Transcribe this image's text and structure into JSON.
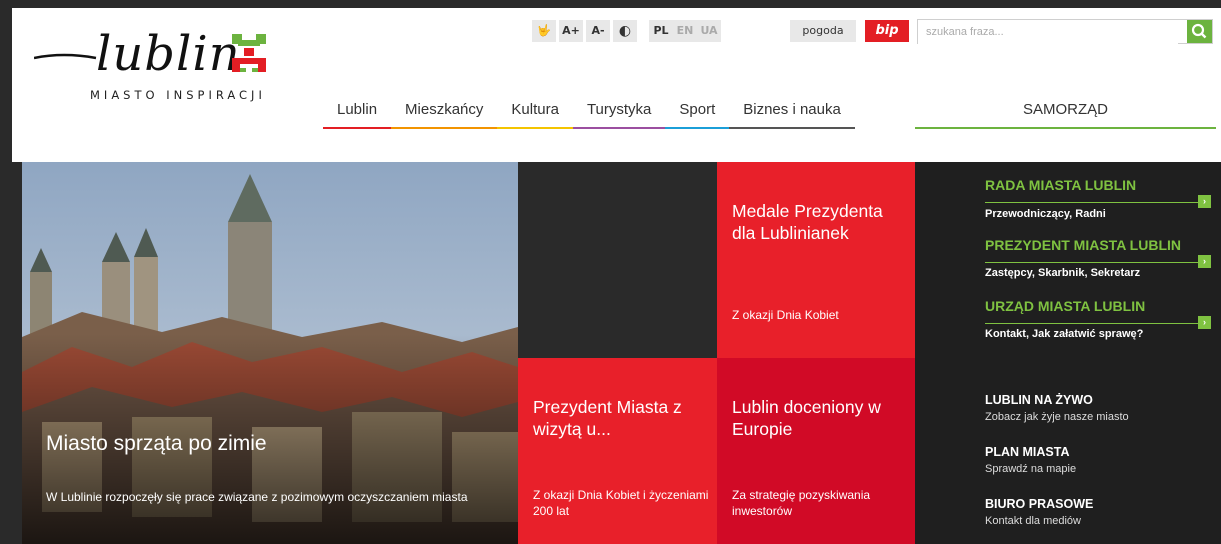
{
  "header": {
    "logo_word": "lublin",
    "logo_subtitle": "MIASTO INSPIRACJI",
    "tools": {
      "sign": "🤟",
      "font_up": "A+",
      "font_down": "A-",
      "contrast": "◐"
    },
    "languages": [
      {
        "code": "PL",
        "active": true
      },
      {
        "code": "EN",
        "active": false
      },
      {
        "code": "UA",
        "active": false
      }
    ],
    "weather_label": "pogoda",
    "bip_label": "bip",
    "search": {
      "placeholder": "szukana fraza..."
    },
    "nav": [
      {
        "label": "Lublin",
        "color": "#e31e24"
      },
      {
        "label": "Mieszkańcy",
        "color": "#f29400"
      },
      {
        "label": "Kultura",
        "color": "#f4c400"
      },
      {
        "label": "Turystyka",
        "color": "#9b4fa0"
      },
      {
        "label": "Sport",
        "color": "#1b9fd8"
      },
      {
        "label": "Biznes i nauka",
        "color": "#555555"
      }
    ],
    "samorzad_label": "SAMORZĄD"
  },
  "hero": {
    "title": "Miasto sprząta po zimie",
    "description": "W Lublinie rozpoczęły się prace związane z pozimowym oczyszczaniem miasta"
  },
  "tiles": [
    {
      "title": "Medale Prezydenta dla Lublinianek",
      "subtitle": "Z okazji Dnia Kobiet"
    },
    {
      "title": "Prezydent Miasta z wizytą u...",
      "subtitle": "Z okazji Dnia Kobiet i życzeniami 200 lat"
    },
    {
      "title": "Lublin doceniony w Europie",
      "subtitle": "Za strategię pozyskiwania inwestorów"
    }
  ],
  "sidebar": {
    "sections": [
      {
        "heading": "RADA MIASTA LUBLIN",
        "sub": "Przewodniczący, Radni"
      },
      {
        "heading": "PREZYDENT MIASTA LUBLIN",
        "sub": "Zastępcy, Skarbnik, Sekretarz"
      },
      {
        "heading": "URZĄD MIASTA LUBLIN",
        "sub": "Kontakt, Jak załatwić sprawę?"
      }
    ],
    "arrow": "›",
    "links": [
      {
        "heading": "LUBLIN NA ŻYWO",
        "sub": "Zobacz jak żyje nasze miasto"
      },
      {
        "heading": "PLAN MIASTA",
        "sub": "Sprawdź na mapie"
      },
      {
        "heading": "BIURO PRASOWE",
        "sub": "Kontakt dla mediów"
      }
    ]
  },
  "colors": {
    "accent_green": "#7fc241",
    "tile_red": "#e8202a",
    "tile_dark_red": "#d10a26"
  }
}
